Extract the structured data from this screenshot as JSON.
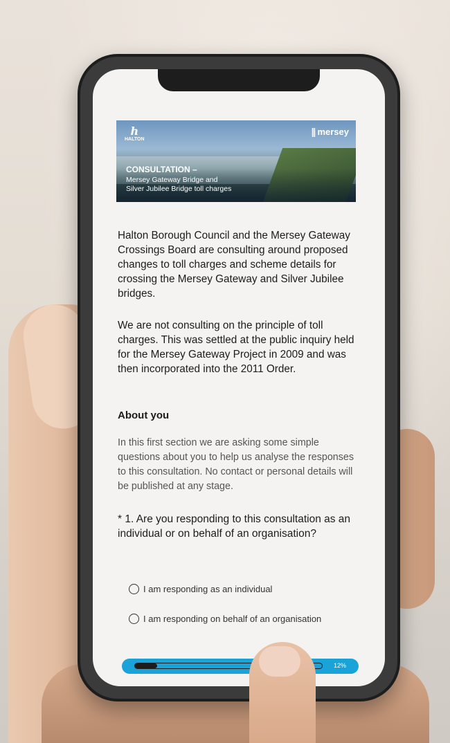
{
  "banner": {
    "logo_left": "HALTON",
    "logo_right": "mersey",
    "title": "CONSULTATION –",
    "subtitle_line1": "Mersey Gateway Bridge and",
    "subtitle_line2": "Silver Jubilee Bridge toll charges"
  },
  "intro": {
    "paragraph1": "Halton Borough Council and the Mersey Gateway Crossings Board are consulting around proposed changes to toll charges and scheme details for crossing the Mersey Gateway and Silver Jubilee bridges.",
    "paragraph2": "We are not consulting on the principle of toll charges. This was settled at the public inquiry held for the Mersey Gateway Project in 2009 and was then incorporated into the 2011 Order."
  },
  "about": {
    "heading": "About you",
    "description": "In this first section we are asking some simple questions about you to help us analyse the responses to this consultation. No contact or personal details will be published at any stage."
  },
  "question1": {
    "text": "* 1. Are you responding to this consultation as an individual or on behalf of an organisation?",
    "options": [
      "I am responding as an individual",
      "I am responding on behalf of an organisation"
    ]
  },
  "progress": {
    "label": "12%",
    "value": 0.12
  },
  "colors": {
    "accent": "#1aa3d8",
    "text": "#1c1c1c",
    "muted": "#555555"
  }
}
